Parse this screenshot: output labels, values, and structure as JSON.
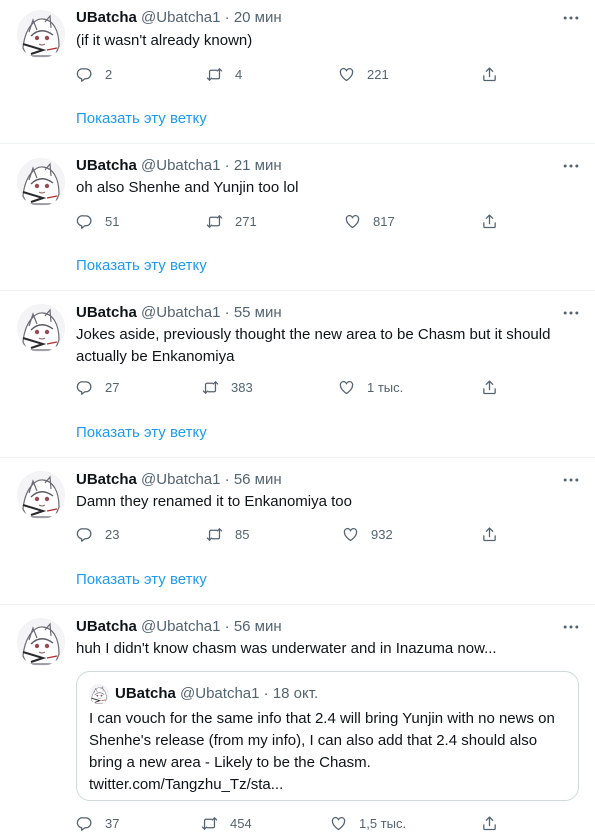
{
  "tweets": [
    {
      "name": "UBatcha",
      "handle": "@Ubatcha1",
      "dot": "·",
      "time": "20 мин",
      "text": "(if it wasn't already known)",
      "replies": "2",
      "retweets": "4",
      "likes": "221",
      "thread_link": "Показать эту ветку"
    },
    {
      "name": "UBatcha",
      "handle": "@Ubatcha1",
      "dot": "·",
      "time": "21 мин",
      "text": "oh also Shenhe and Yunjin too lol",
      "replies": "51",
      "retweets": "271",
      "likes": "817",
      "thread_link": "Показать эту ветку"
    },
    {
      "name": "UBatcha",
      "handle": "@Ubatcha1",
      "dot": "·",
      "time": "55 мин",
      "text": "Jokes aside, previously thought the new area to be Chasm but it should actually be Enkanomiya",
      "replies": "27",
      "retweets": "383",
      "likes": "1 тыс.",
      "thread_link": "Показать эту ветку"
    },
    {
      "name": "UBatcha",
      "handle": "@Ubatcha1",
      "dot": "·",
      "time": "56 мин",
      "text": "Damn they renamed it to Enkanomiya too",
      "replies": "23",
      "retweets": "85",
      "likes": "932",
      "thread_link": "Показать эту ветку"
    },
    {
      "name": "UBatcha",
      "handle": "@Ubatcha1",
      "dot": "·",
      "time": "56 мин",
      "text": "huh I didn't know chasm was underwater and in Inazuma now...",
      "replies": "37",
      "retweets": "454",
      "likes": "1,5 тыс.",
      "quote": {
        "name": "UBatcha",
        "handle": "@Ubatcha1",
        "dot": "·",
        "time": "18 окт.",
        "text": "I can vouch for the same info that 2.4 will bring Yunjin with no news on Shenhe's release (from my info), I can also add that 2.4 should also bring a new area - Likely to be the Chasm. twitter.com/Tangzhu_Tz/sta..."
      }
    }
  ],
  "icons": {
    "reply": "reply-icon",
    "retweet": "retweet-icon",
    "like": "heart-icon",
    "share": "share-icon",
    "more": "more-icon"
  },
  "colors": {
    "link": "#1d9bf0",
    "secondary_text": "#536471",
    "divider": "#eff3f4"
  }
}
